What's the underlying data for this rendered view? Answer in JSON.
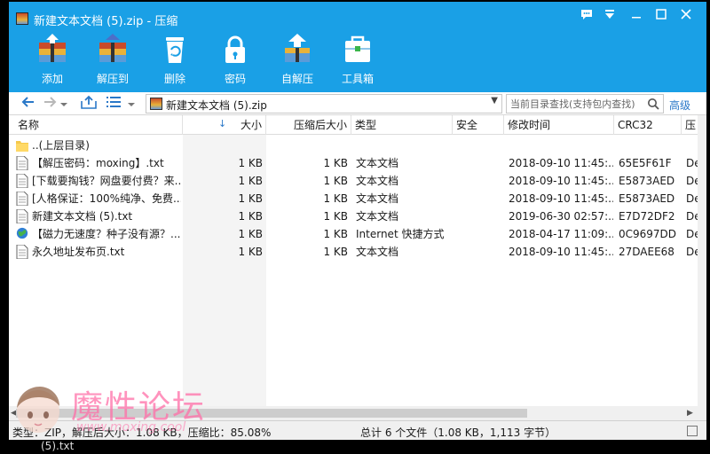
{
  "window": {
    "title": "新建文本文档 (5).zip - 压缩",
    "controls": [
      "chat-icon",
      "menu-icon",
      "minimize-icon",
      "maximize-icon",
      "close-icon"
    ]
  },
  "toolbar": {
    "buttons": [
      {
        "label": "添加",
        "icon": "add-archive-icon"
      },
      {
        "label": "解压到",
        "icon": "extract-to-icon"
      },
      {
        "label": "删除",
        "icon": "delete-icon"
      },
      {
        "label": "密码",
        "icon": "lock-icon"
      },
      {
        "label": "自解压",
        "icon": "self-extract-icon"
      },
      {
        "label": "工具箱",
        "icon": "toolbox-icon"
      }
    ]
  },
  "address": {
    "path": "新建文本文档 (5).zip",
    "search_placeholder": "当前目录查找(支持包内查找)",
    "advanced_label": "高级"
  },
  "columns": [
    "名称",
    "大小",
    "压缩后大小",
    "类型",
    "安全",
    "修改时间",
    "CRC32",
    "压"
  ],
  "files": [
    {
      "name": "..(上层目录)",
      "size": "",
      "packed": "",
      "type": "",
      "security": "",
      "modified": "",
      "crc": "",
      "extra": "",
      "icon": "folder-icon"
    },
    {
      "name": "【解压密码：moxing】.txt",
      "size": "1 KB",
      "packed": "1 KB",
      "type": "文本文档",
      "security": "",
      "modified": "2018-09-10 11:45:...",
      "crc": "65E5F61F",
      "extra": "De",
      "icon": "text-file-icon"
    },
    {
      "name": "[下载要掏钱？网盘要付费？来...",
      "size": "1 KB",
      "packed": "1 KB",
      "type": "文本文档",
      "security": "",
      "modified": "2018-09-10 11:45:...",
      "crc": "E5873AED",
      "extra": "De",
      "icon": "text-file-icon"
    },
    {
      "name": "[人格保证：100%纯净、免费...",
      "size": "1 KB",
      "packed": "1 KB",
      "type": "文本文档",
      "security": "",
      "modified": "2018-09-10 11:45:...",
      "crc": "E5873AED",
      "extra": "De",
      "icon": "text-file-icon"
    },
    {
      "name": "新建文本文档 (5).txt",
      "size": "1 KB",
      "packed": "1 KB",
      "type": "文本文档",
      "security": "",
      "modified": "2019-06-30 02:57:...",
      "crc": "E7D72DF2",
      "extra": "De",
      "icon": "text-file-icon"
    },
    {
      "name": "【磁力无速度？种子没有源？...",
      "size": "1 KB",
      "packed": "1 KB",
      "type": "Internet 快捷方式",
      "security": "",
      "modified": "2018-04-17 11:09:...",
      "crc": "0C9697DD",
      "extra": "De",
      "icon": "internet-shortcut-icon"
    },
    {
      "name": "永久地址发布页.txt",
      "size": "1 KB",
      "packed": "1 KB",
      "type": "文本文档",
      "security": "",
      "modified": "2018-09-10 11:45:...",
      "crc": "27DAEE68",
      "extra": "De",
      "icon": "text-file-icon"
    }
  ],
  "status": {
    "left": "类型：ZIP，解压后大小：1.08 KB，压缩比：85.08%",
    "center": "总计 6 个文件（1.08 KB，1,113 字节）"
  },
  "watermark": {
    "text": "魔性论坛",
    "url": "www.moxing.cool"
  },
  "desktop_fragment": "(5).txt",
  "colors": {
    "titlebar": "#1aa0e6",
    "link": "#2a78c8",
    "watermark": "#ff6fa8"
  }
}
